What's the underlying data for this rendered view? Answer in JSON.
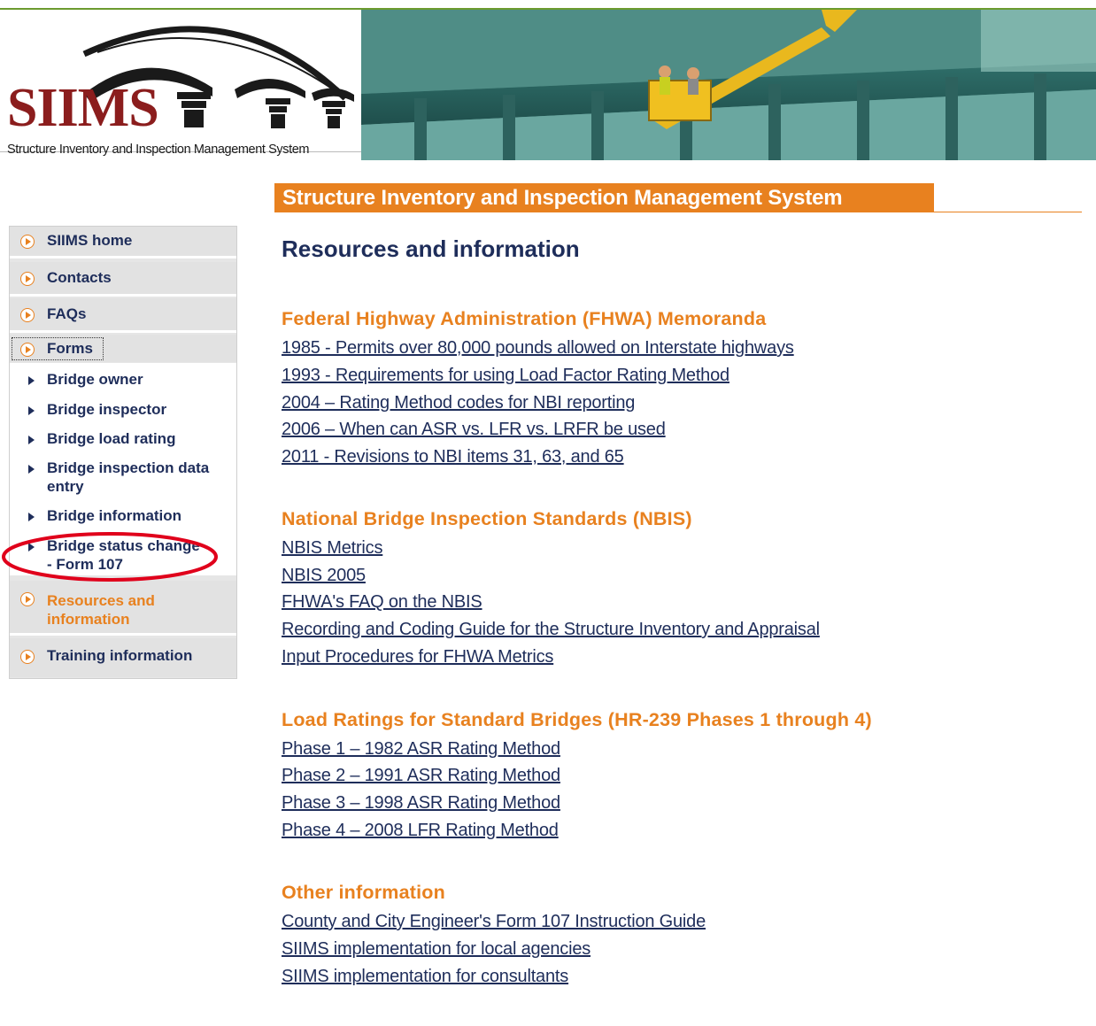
{
  "banner": {
    "logo_text": "SIIMS",
    "logo_subtitle": "Structure Inventory and Inspection Management System"
  },
  "title_bar": {
    "text": "Structure Inventory and Inspection Management System"
  },
  "sidebar": {
    "items": [
      {
        "label": "SIIMS home"
      },
      {
        "label": "Contacts"
      },
      {
        "label": "FAQs"
      },
      {
        "label": "Forms"
      },
      {
        "label": "Resources and information"
      },
      {
        "label": "Training information"
      }
    ],
    "forms_subitems": [
      {
        "label": "Bridge owner"
      },
      {
        "label": "Bridge inspector"
      },
      {
        "label": "Bridge load rating"
      },
      {
        "label": "Bridge inspection data entry"
      },
      {
        "label": "Bridge information"
      },
      {
        "label": "Bridge status change - Form 107"
      }
    ]
  },
  "main": {
    "heading": "Resources and information",
    "sections": [
      {
        "title": "Federal Highway Administration (FHWA) Memoranda",
        "links": [
          "1985 - Permits over 80,000 pounds allowed on Interstate highways",
          "1993 - Requirements for using Load Factor Rating Method",
          "2004 – Rating Method codes for NBI reporting",
          "2006 – When can ASR vs. LFR vs. LRFR be used",
          "2011 - Revisions to NBI items 31, 63, and 65"
        ]
      },
      {
        "title": "National Bridge Inspection Standards (NBIS)",
        "links": [
          "NBIS Metrics",
          "NBIS 2005",
          "FHWA's FAQ on the NBIS",
          "Recording and Coding Guide for the Structure Inventory and Appraisal",
          "Input Procedures for FHWA Metrics"
        ]
      },
      {
        "title": "Load Ratings for Standard Bridges (HR-239 Phases 1 through 4)",
        "links": [
          "Phase 1 – 1982 ASR Rating Method",
          "Phase 2 – 1991 ASR Rating Method",
          "Phase 3 – 1998 ASR Rating Method",
          "Phase 4 – 2008 LFR Rating Method"
        ]
      },
      {
        "title": "Other information",
        "links": [
          "County and City Engineer's Form 107 Instruction Guide",
          "SIIMS implementation for local agencies",
          "SIIMS implementation for consultants"
        ]
      }
    ]
  },
  "colors": {
    "accent_orange": "#e8811f",
    "navy_text": "#1e2d5a",
    "logo_red": "#8b1d1d",
    "annotation_red": "#e0001b"
  }
}
